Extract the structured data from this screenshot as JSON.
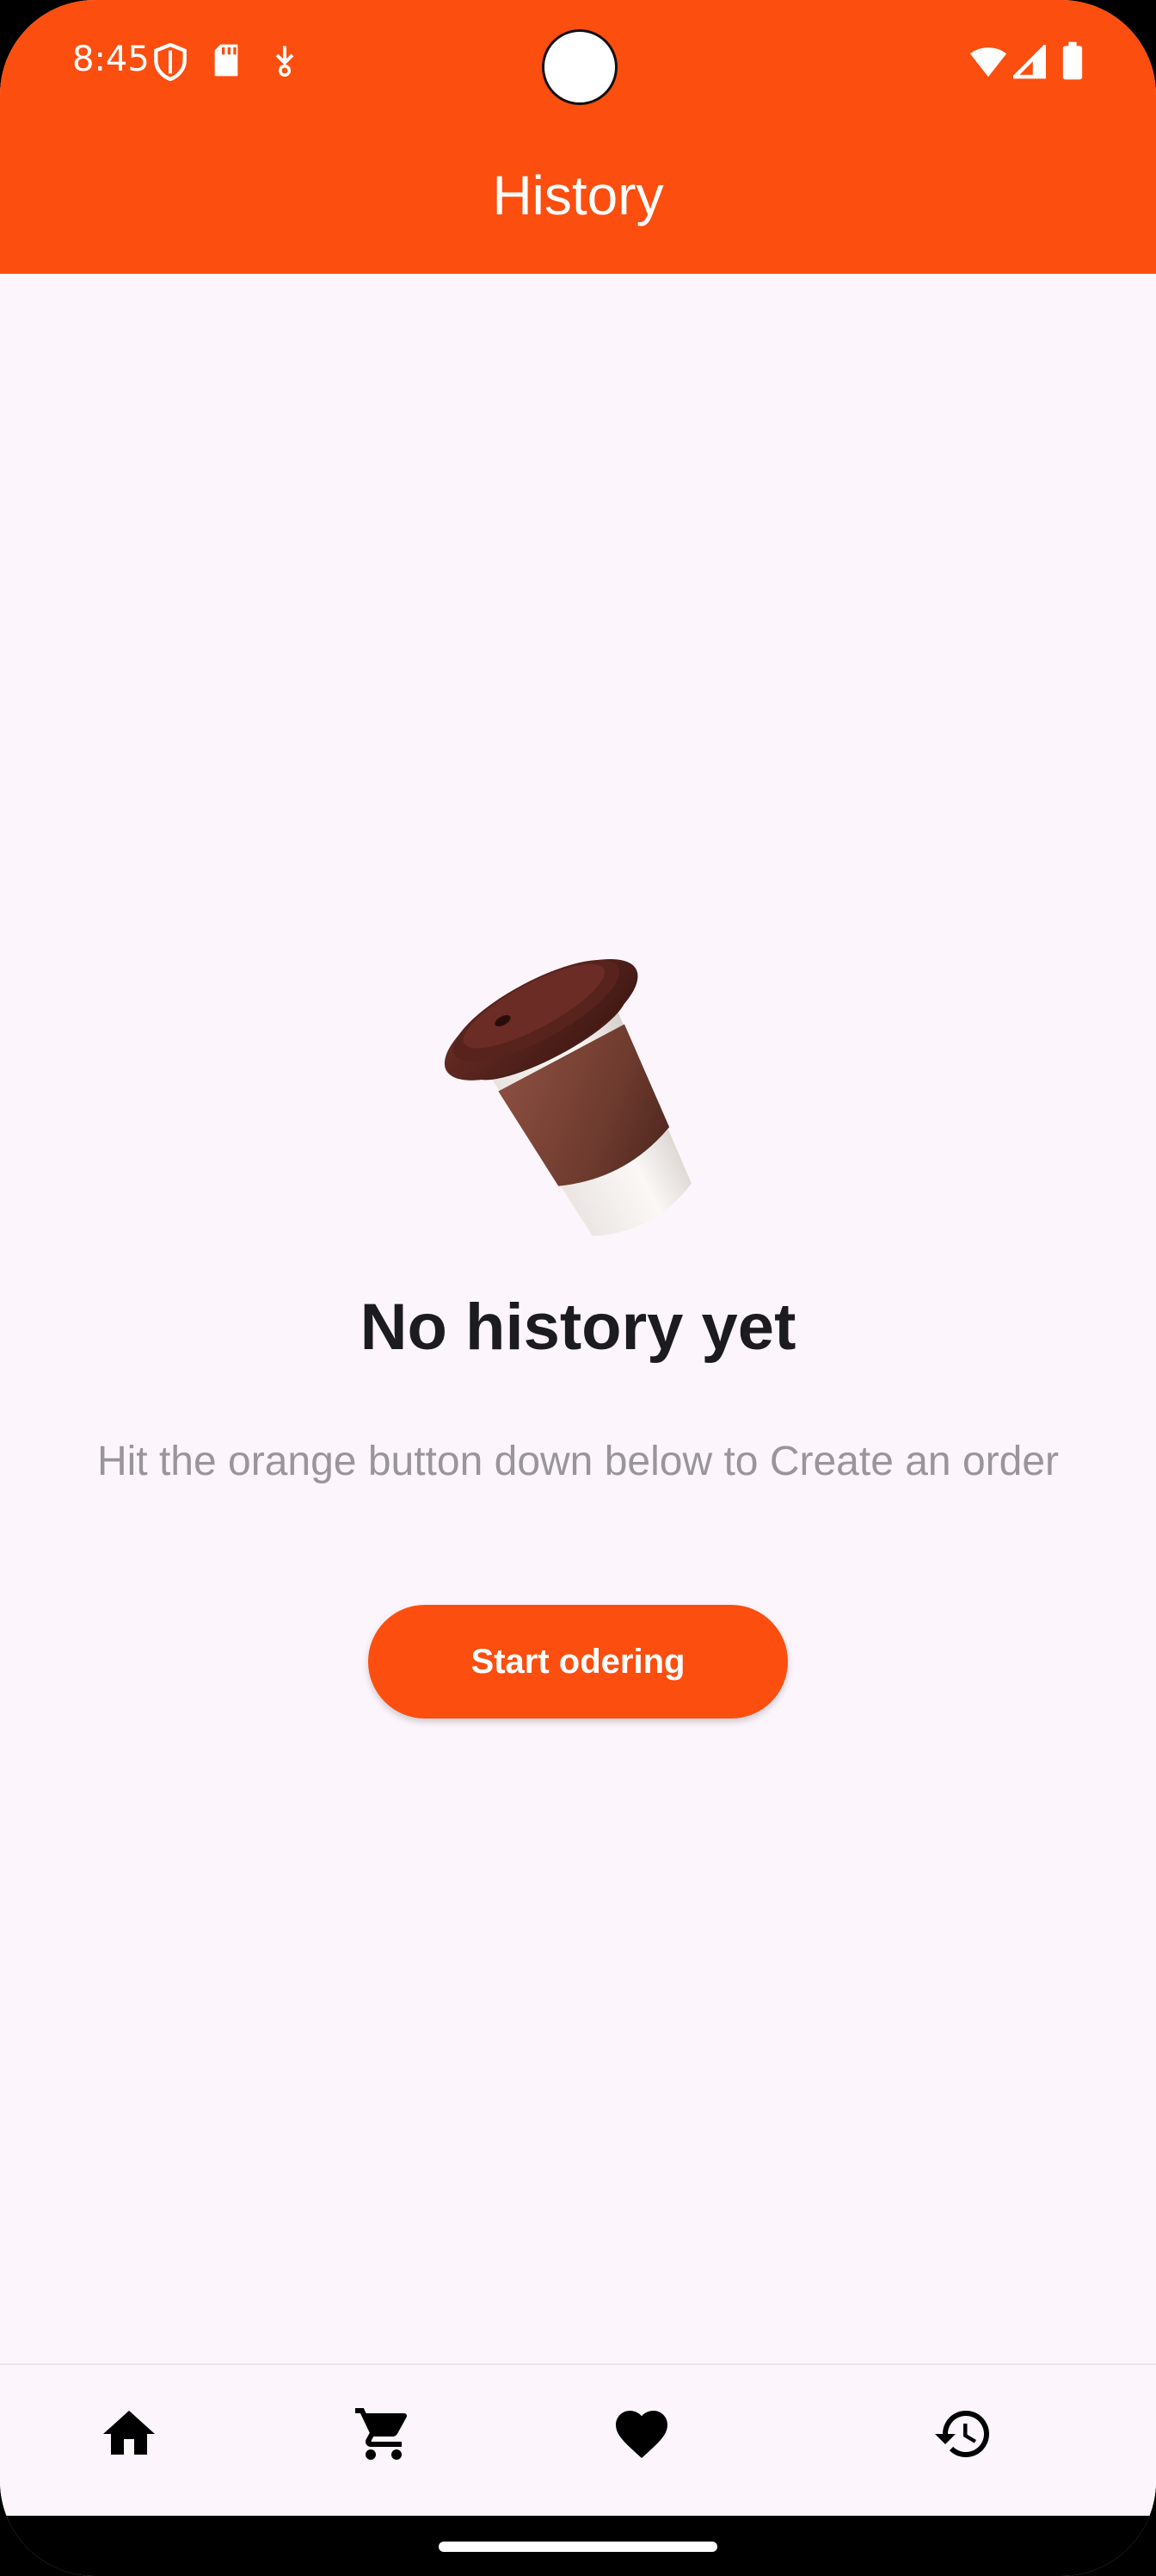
{
  "status_bar": {
    "time": "8:45",
    "icons_left": [
      "shield-icon",
      "sd-card-icon",
      "download-icon"
    ],
    "icons_right": [
      "wifi-icon",
      "signal-icon",
      "battery-icon"
    ]
  },
  "header": {
    "title": "History",
    "color": "#fb4e0f"
  },
  "empty_state": {
    "illustration": "coffee-cup-icon",
    "headline": "No history yet",
    "subtitle": "Hit the orange button down below to Create an order",
    "button_label": "Start odering"
  },
  "bottom_nav": {
    "items": [
      {
        "icon": "home-icon",
        "name": "Home"
      },
      {
        "icon": "cart-icon",
        "name": "Cart"
      },
      {
        "icon": "heart-icon",
        "name": "Favorites"
      },
      {
        "icon": "history-icon",
        "name": "History"
      }
    ]
  },
  "colors": {
    "accent": "#fb4e0f",
    "background": "#fcf5fc",
    "headline": "#1c1b1f",
    "subtitle": "#9a949b"
  }
}
